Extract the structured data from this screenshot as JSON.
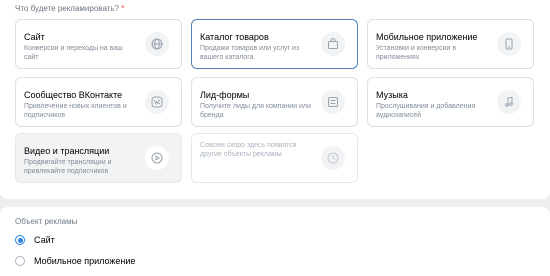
{
  "question": {
    "text": "Что будете рекламировать?",
    "required_mark": "*"
  },
  "cards": [
    {
      "title": "Сайт",
      "desc": "Конверсии и переходы на ваш сайт",
      "icon": "globe-icon"
    },
    {
      "title": "Каталог товаров",
      "desc": "Продажи товаров или услуг из вашего каталога",
      "icon": "shopping-bag-icon"
    },
    {
      "title": "Мобильное приложение",
      "desc": "Установки и конверсии в приложениях",
      "icon": "smartphone-icon"
    },
    {
      "title": "Сообщество ВКонтакте",
      "desc": "Привлечение новых клиентов и подписчиков",
      "icon": "vk-logo-icon"
    },
    {
      "title": "Лид-формы",
      "desc": "Получите лиды для компании или бренда",
      "icon": "form-list-icon"
    },
    {
      "title": "Музыка",
      "desc": "Прослушивания и добавления аудиозаписей",
      "icon": "music-note-icon"
    },
    {
      "title": "Видео и трансляции",
      "desc": "Продвигайте трансляции и привлекайте подписчиков",
      "icon": "play-icon"
    },
    {
      "title": "",
      "desc": "Совсем скоро здесь появятся другие объекты рекламы",
      "icon": "clock-icon"
    }
  ],
  "selected_card": "Каталог товаров",
  "object": {
    "label": "Объект рекламы",
    "options": [
      {
        "label": "Сайт",
        "checked": true
      },
      {
        "label": "Мобильное приложение",
        "checked": false
      }
    ]
  },
  "colors": {
    "accent": "#2d81e0",
    "selected_border": "#5181b8",
    "muted_text": "#818c99"
  }
}
